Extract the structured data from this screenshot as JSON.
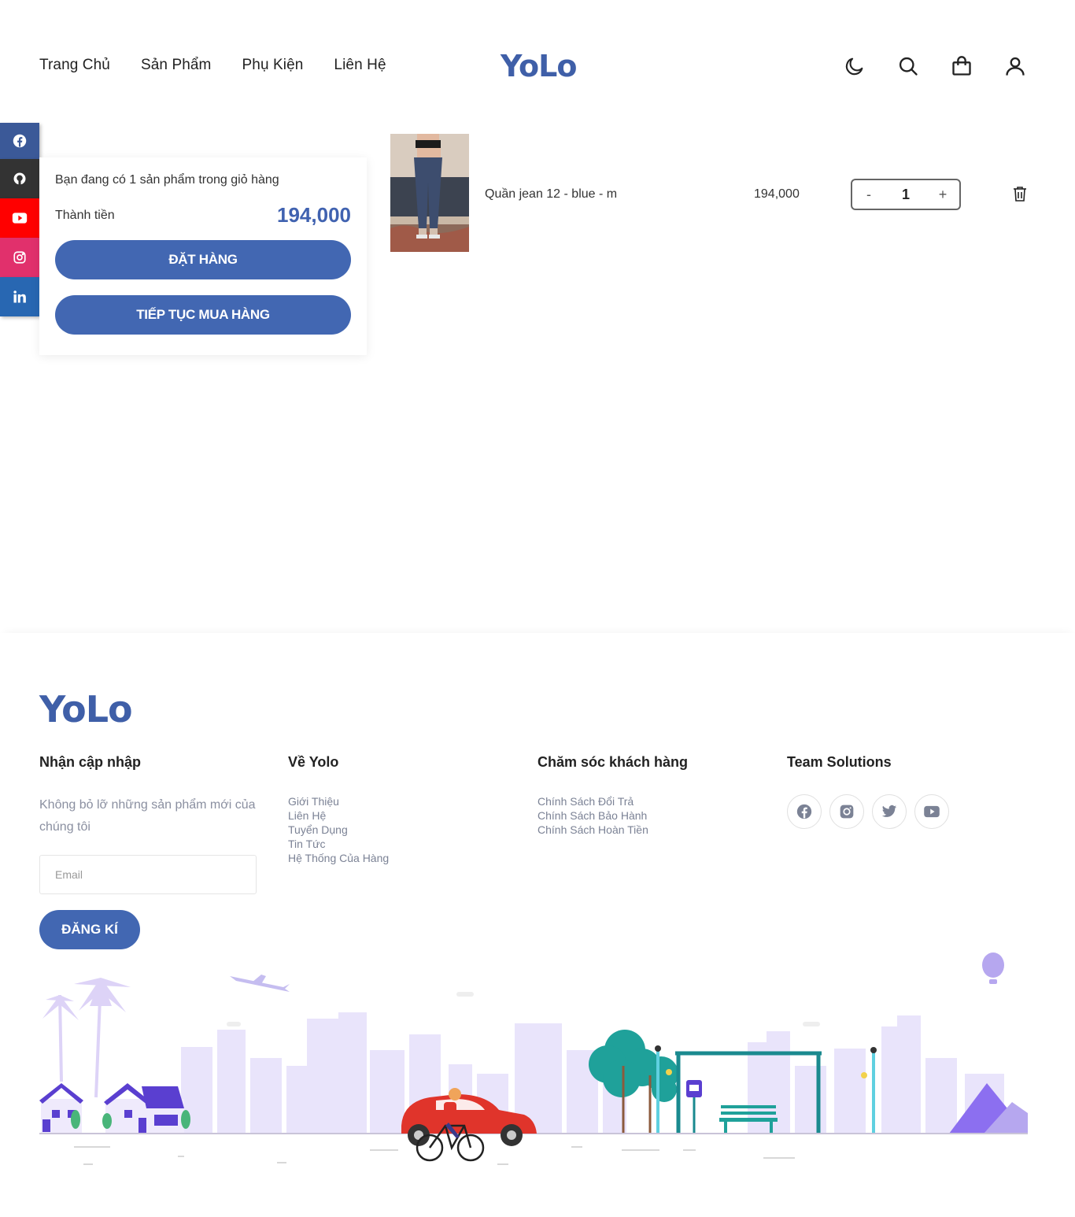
{
  "nav": {
    "items": [
      "Trang Chủ",
      "Sản Phẩm",
      "Phụ Kiện",
      "Liên Hệ"
    ],
    "logo": "YoLo",
    "icons": [
      "moon-icon",
      "search-icon",
      "shopping-bag-icon",
      "user-icon"
    ]
  },
  "social_bar": [
    "facebook-icon",
    "github-icon",
    "youtube-icon",
    "instagram-icon",
    "linkedin-icon"
  ],
  "cart": {
    "summary_text": "Bạn đang có 1 sản phẩm trong giỏ hàng",
    "total_label": "Thành tiền",
    "total_value": "194,000",
    "checkout_label": "ĐẶT HÀNG",
    "continue_label": "TIẾP TỤC MUA HÀNG",
    "items": [
      {
        "name": "Quần jean 12 - blue - m",
        "price": "194,000",
        "quantity": "1",
        "minus": "-",
        "plus": "+"
      }
    ]
  },
  "footer": {
    "logo": "YoLo",
    "newsletter": {
      "title": "Nhận cập nhập",
      "description": "Không bỏ lỡ những sản phẩm mới của chúng tôi",
      "email_placeholder": "Email",
      "button": "ĐĂNG KÍ"
    },
    "about": {
      "title": "Về Yolo",
      "links": [
        "Giới Thiệu",
        "Liên Hệ",
        "Tuyển Dụng",
        "Tin Tức",
        "Hệ Thống Của Hàng"
      ]
    },
    "care": {
      "title": "Chăm sóc khách hàng",
      "links": [
        "Chính Sách Đổi Trả",
        "Chính Sách Bảo Hành",
        "Chính Sách Hoàn Tiền"
      ]
    },
    "team": {
      "title": "Team Solutions",
      "social": [
        "facebook-icon",
        "instagram-icon",
        "twitter-icon",
        "youtube-icon"
      ]
    }
  },
  "colors": {
    "brand": "#4267b2",
    "logo": "#3f5fa8",
    "city": "#e6e1f9"
  }
}
